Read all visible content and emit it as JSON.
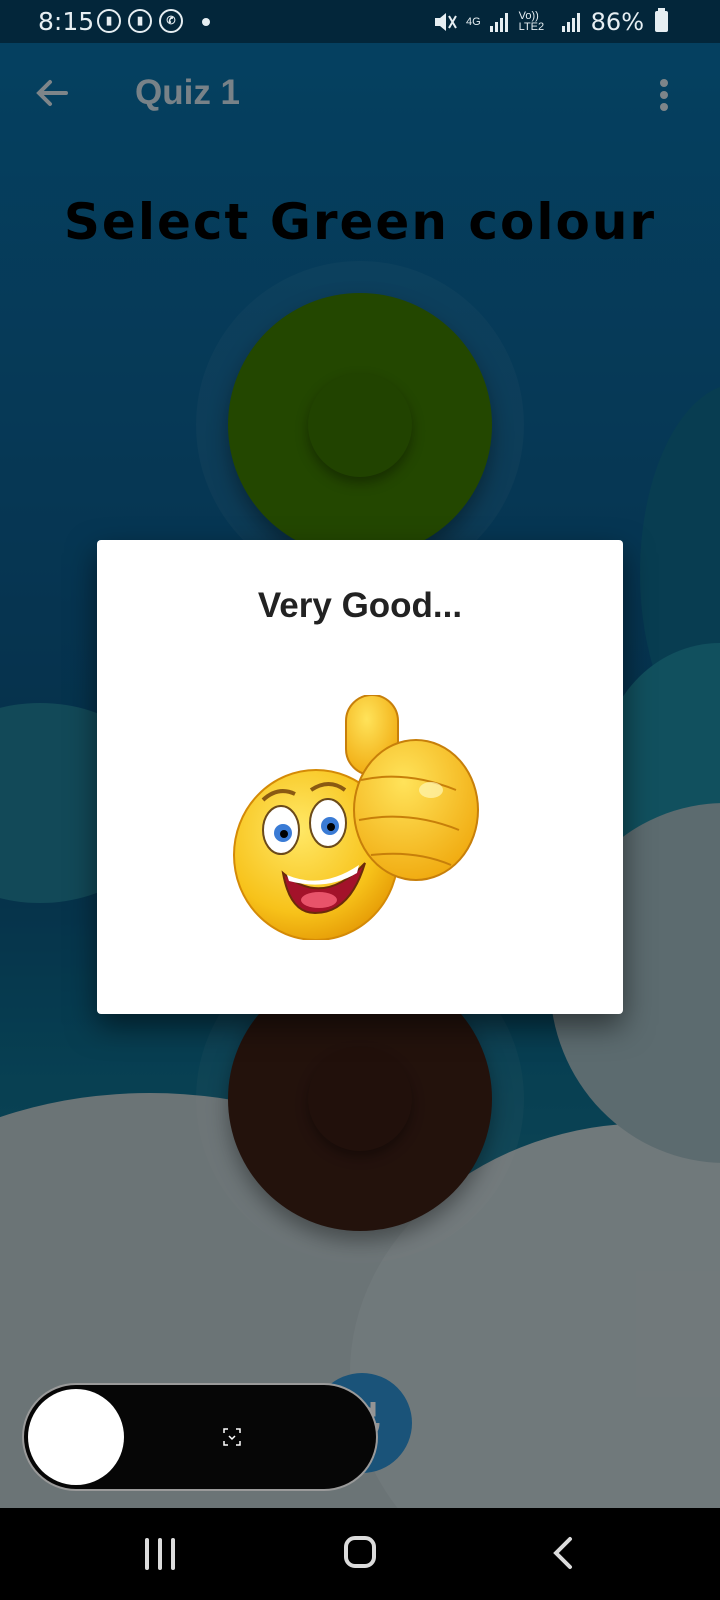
{
  "status_bar": {
    "time": "8:15",
    "battery": "86%",
    "network_1": "4G",
    "network_2": "Vo)) LTE2",
    "icons": [
      "chat-icon",
      "chat-icon",
      "whatsapp-icon",
      "dot-icon",
      "mute-icon",
      "signal-icon",
      "signal-icon",
      "battery-icon"
    ]
  },
  "app_bar": {
    "title": "Quiz 1",
    "back_icon": "arrow-back-icon",
    "menu_icon": "more-vert-icon"
  },
  "quiz": {
    "question": "Select Green colour",
    "options": [
      {
        "name": "green",
        "color": "#3d7a00"
      },
      {
        "name": "brown",
        "color": "#3d1f16"
      }
    ]
  },
  "dialog": {
    "title": "Very Good...",
    "image": "thumbs-up-emoji"
  },
  "floating_toggle": {
    "icon": "screenshot-icon"
  },
  "nav_bar": {
    "recent": "recent-apps-icon",
    "home": "home-icon",
    "back": "back-icon"
  }
}
